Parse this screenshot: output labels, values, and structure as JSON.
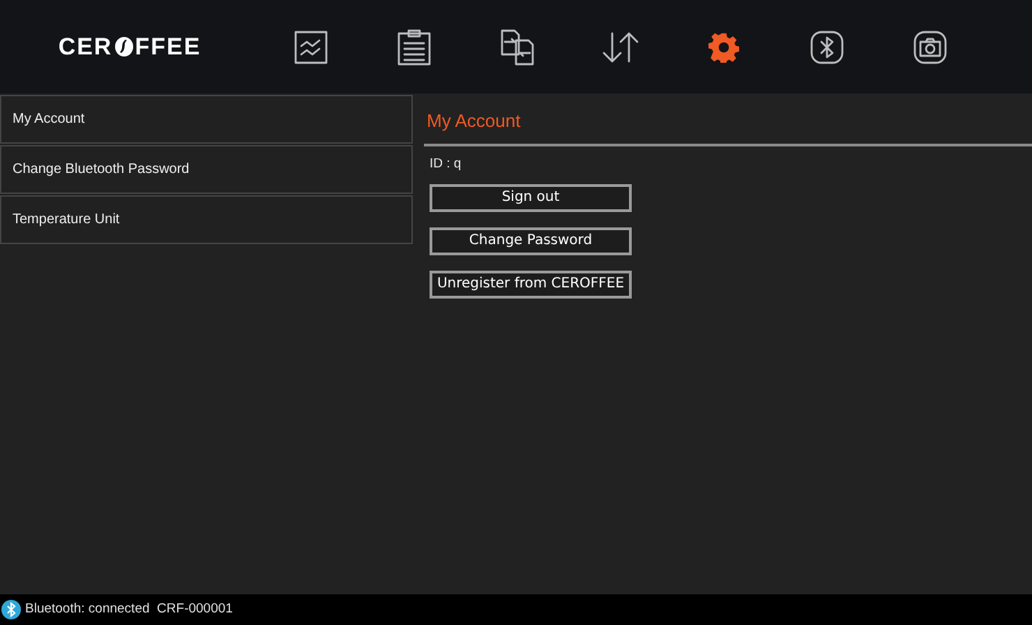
{
  "logo": {
    "before": "CER",
    "after": "FFEE"
  },
  "toolbar": [
    {
      "kind": "chart",
      "selected": false
    },
    {
      "kind": "clipboard",
      "selected": false
    },
    {
      "kind": "transfer",
      "selected": false
    },
    {
      "kind": "sort",
      "selected": false
    },
    {
      "kind": "settings",
      "selected": true
    },
    {
      "kind": "bluetooth",
      "selected": false
    },
    {
      "kind": "camera",
      "selected": false
    }
  ],
  "sidebar": {
    "items": [
      "My Account",
      "Change Bluetooth Password",
      "Temperature Unit"
    ]
  },
  "panel": {
    "title": "My Account",
    "id_line": "ID : q",
    "buttons": [
      "Sign out",
      "Change Password",
      "Unregister from CEROFFEE"
    ]
  },
  "status_bar": {
    "text": "Bluetooth: connected  CRF-000001"
  }
}
